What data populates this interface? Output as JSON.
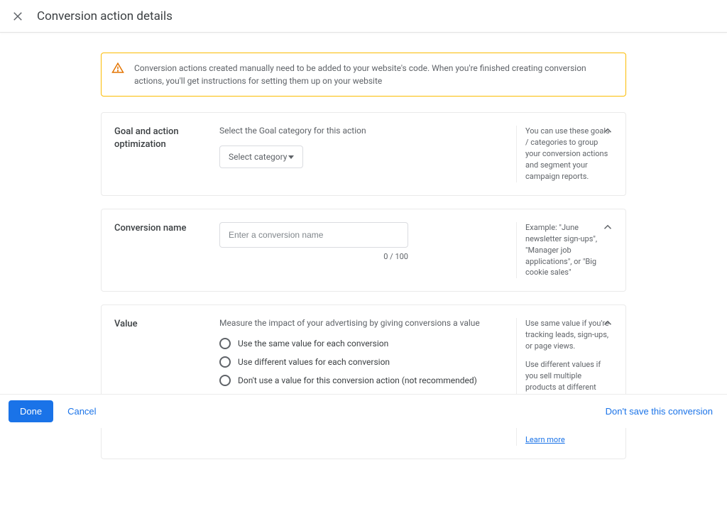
{
  "header": {
    "title": "Conversion action details"
  },
  "alert": {
    "text": "Conversion actions created manually need to be added to your website's code. When you're finished creating conversion actions, you'll get instructions for setting them up on your website"
  },
  "goal": {
    "title": "Goal and action optimization",
    "label": "Select the Goal category for this action",
    "select_placeholder": "Select category",
    "help": "You can use these goals / categories to group your conversion actions and segment your campaign reports."
  },
  "name_section": {
    "title": "Conversion name",
    "placeholder": "Enter a conversion name",
    "counter": "0 / 100",
    "help": "Example: \"June newsletter sign-ups\", \"Manager job applications\", or \"Big cookie sales\""
  },
  "value_section": {
    "title": "Value",
    "label": "Measure the impact of your advertising by giving conversions a value",
    "options": [
      "Use the same value for each conversion",
      "Use different values for each conversion",
      "Don't use a value for this conversion action (not recommended)"
    ],
    "help1": "Use same value if you're tracking leads, sign-ups, or page views.",
    "help2": "Use different values if you sell multiple products at different prices and you'd like a unique value recorded for each conversion.",
    "learn_more": "Learn more"
  },
  "footer": {
    "done": "Done",
    "cancel": "Cancel",
    "dont_save": "Don't save this conversion"
  }
}
